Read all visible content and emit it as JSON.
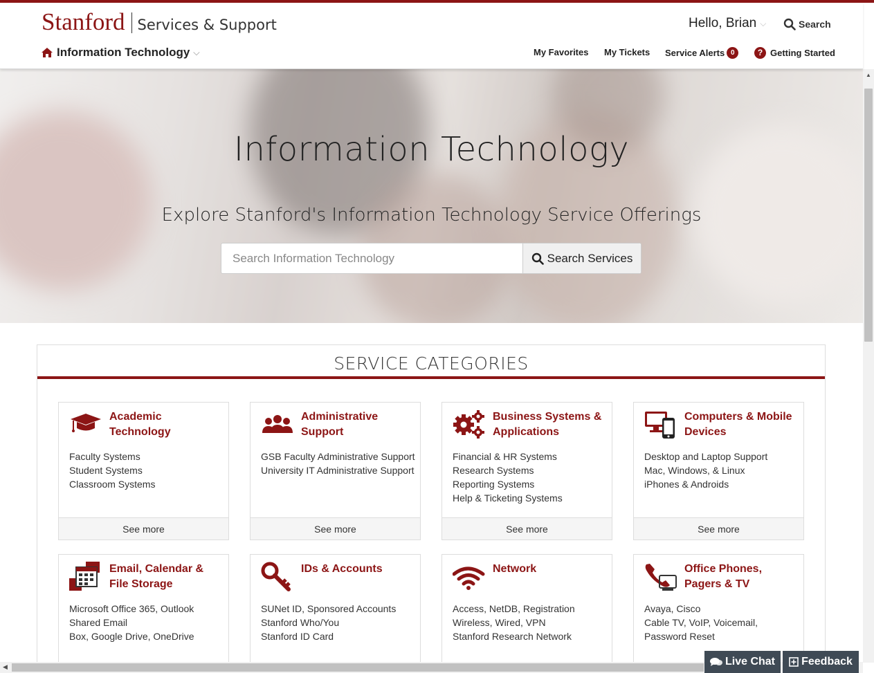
{
  "header": {
    "brand": "Stanford",
    "brand_sub": "Services & Support",
    "department": "Information Technology",
    "greeting": "Hello, Brian",
    "search_label": "Search",
    "nav": {
      "favorites": "My Favorites",
      "tickets": "My Tickets",
      "alerts": "Service Alerts",
      "alerts_count": "0",
      "getting_started": "Getting Started"
    }
  },
  "hero": {
    "title": "Information Technology",
    "subtitle": "Explore Stanford's Information Technology Service Offerings",
    "search_placeholder": "Search Information Technology",
    "search_button": "Search Services"
  },
  "categories": {
    "heading": "SERVICE CATEGORIES",
    "see_more": "See more",
    "cards": [
      {
        "title": "Academic Technology",
        "icon": "graduation-cap-icon",
        "items": [
          "Faculty Systems",
          "Student Systems",
          "Classroom Systems"
        ]
      },
      {
        "title": "Administrative Support",
        "icon": "users-icon",
        "items": [
          "GSB Faculty Administrative Support",
          "University IT Administrative Support"
        ]
      },
      {
        "title": "Business Systems & Applications",
        "icon": "gears-icon",
        "items": [
          "Financial & HR Systems",
          "Research Systems",
          "Reporting Systems",
          "Help & Ticketing Systems"
        ]
      },
      {
        "title": "Computers & Mobile Devices",
        "icon": "devices-icon",
        "items": [
          "Desktop and Laptop Support",
          "Mac, Windows, & Linux",
          "iPhones & Androids"
        ]
      },
      {
        "title": "Email, Calendar & File Storage",
        "icon": "calendar-files-icon",
        "items": [
          "Microsoft Office 365, Outlook",
          "Shared Email",
          "Box, Google Drive, OneDrive"
        ]
      },
      {
        "title": "IDs & Accounts",
        "icon": "key-icon",
        "items": [
          "SUNet ID, Sponsored Accounts",
          "Stanford Who/You",
          "Stanford ID Card"
        ]
      },
      {
        "title": "Network",
        "icon": "wifi-icon",
        "items": [
          "Access, NetDB, Registration",
          "Wireless, Wired, VPN",
          "Stanford Research Network"
        ]
      },
      {
        "title": "Office Phones, Pagers & TV",
        "icon": "phone-icon",
        "items": [
          "Avaya, Cisco",
          "Cable TV, VoIP, Voicemail, Password Reset"
        ]
      }
    ]
  },
  "footer_buttons": {
    "live_chat": "Live Chat",
    "feedback": "Feedback"
  },
  "colors": {
    "cardinal": "#8c1515",
    "dark_button": "#3f4a55"
  }
}
